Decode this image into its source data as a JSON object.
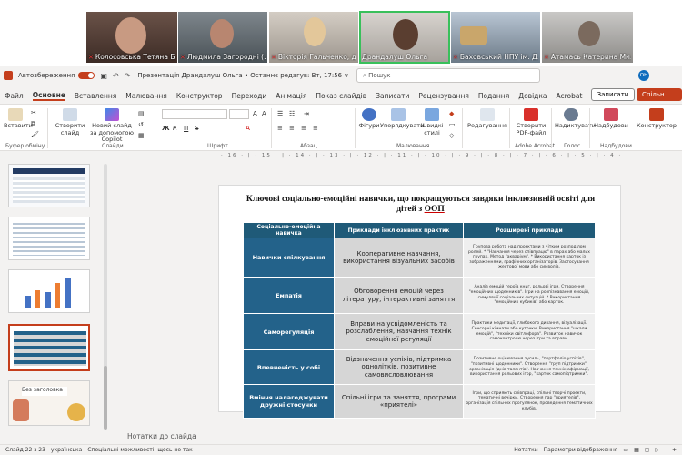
{
  "meeting": {
    "participants": [
      {
        "name": "Колосовська Тетяна Б..."
      },
      {
        "name": "Людмила Загородні (..."
      },
      {
        "name": "Вікторія Гальченко, д..."
      },
      {
        "name": "Драндалуш Ольга"
      },
      {
        "name": "Баховський НПУ ім. Д..."
      },
      {
        "name": "Атамась Катерина Ми..."
      }
    ]
  },
  "titlebar": {
    "autosave_label": "Автозбереження",
    "doc_title": "Презентація Драндалуш Ольга • Останнє редагув: Вт, 17:56 ∨",
    "search_placeholder": "Пошук",
    "user_initials": "ОН"
  },
  "menu": {
    "items": [
      "Файл",
      "Основне",
      "Вставлення",
      "Малювання",
      "Конструктор",
      "Переходи",
      "Анімація",
      "Показ слайдів",
      "Записати",
      "Рецензування",
      "Подання",
      "Довідка",
      "Acrobat"
    ],
    "record_label": "Записати",
    "share_label": "Спільн"
  },
  "ribbon": {
    "paste": "Вставити",
    "create_slide": "Створити слайд",
    "new_slide_copilot": "Новий слайд за допомогою Copilot",
    "groups": {
      "clipboard": "Буфер обміну",
      "slides": "Слайди",
      "font": "Шрифт",
      "paragraph": "Абзац",
      "drawing": "Малювання",
      "voice": "Голос",
      "addins": "Надбудови"
    },
    "figures": "Фігури",
    "arrange": "Упорядкувати",
    "quick_styles": "Швидкі стилі",
    "editing": "Редагування",
    "create_pdf": "Створити PDF-файл",
    "adobe_acrobat": "Adobe Acrobat",
    "dictate": "Надиктувати",
    "addins": "Надбудови",
    "designer": "Конструктор",
    "bold": "Ж",
    "italic": "К",
    "underline": "П",
    "strike": "S"
  },
  "ruler": {
    "text": "· 16 · | · 15 · | · 14 · | · 13 · | · 12 · | · 11 · | · 10 · | · 9 · | · 8 · | · 7 · | · 6 · | · 5 · | · 4 · | · 3 · | · 2 · | · 1 · | · 0 · | · 1 · | · 2 · | · 3 · | · 4 · | · 5 · | · 6 · | · 7 · | · 8 · | · 9 · | · 10 · | · 11 · | · 12 · | · 13 · | · 14 · | · 15 · | · 16"
  },
  "thumbnails": {
    "numbers": [
      "",
      "",
      "",
      "",
      "",
      ""
    ],
    "last_label": "Без заголовка"
  },
  "slide": {
    "title_part1": "Ключові соціально-емоційні навички, що покращуються завдяки інклюзивній освіті для дітей з ",
    "title_part2": "ООП",
    "headers": [
      "Соціально-емоційна навичка",
      "Приклади інклюзивних практик",
      "Розширені приклади"
    ],
    "rows": [
      {
        "skill": "Навички спілкування",
        "practice": "Кооперативне навчання, використання візуальних засобів",
        "examples": "Групова робота над проєктами з чітким розподілом ролей. * \"Навчання через співпрацю\" в парах або малих групах. Метод \"акваріум\". * Використання карток із зображеннями, графічних організаторів. Застосування жестової мови або символів."
      },
      {
        "skill": "Емпатія",
        "practice": "Обговорення емоцій через літературу, інтерактивні заняття",
        "examples": "Аналіз емоцій героїв книг, рольові ігри. Створення \"емоційних щоденників\". Ігри на розпізнавання емоцій, симуляції соціальних ситуацій. * Використання \"емоційних кубиків\" або карток."
      },
      {
        "skill": "Саморегуляція",
        "practice": "Вправи на усвідомленість та розслаблення, навчання технік емоційної регуляції",
        "examples": "Практики медитації, глибокого дихання, візуалізації. Сенсорні кімнати або куточки. Використання \"шкали емоцій\", \"техніки світлофора\". Розвиток навичок самоконтролю через ігри та вправи."
      },
      {
        "skill": "Впевненість у собі",
        "practice": "Відзначення успіхів, підтримка однолітків, позитивне самовисловлювання",
        "examples": "Позитивне оцінювання зусиль, \"портфоліо успіхів\", \"позитивні щоденники\". Створення \"груп підтримки\", організація \"днів талантів\". Навчання технік афірмації, використання рольових ігор, \"карток самопідтримки\"."
      },
      {
        "skill": "Вміння налагоджувати дружні стосунки",
        "practice": "Спільні ігри та заняття, програми «приятелі»",
        "examples": "Ігри, що сприяють співпраці, спільні творчі проєкти, тематичні вечірки. Створення пар \"приятелів\", організація спільних прогулянок, проведення тематичних клубів."
      }
    ]
  },
  "notes": {
    "placeholder": "Нотатки до слайда"
  },
  "status": {
    "slide_info": "Слайд 22 з 23",
    "language": "українська",
    "accessibility": "Спеціальні можливості: щось не так",
    "notes": "Нотатки",
    "display": "Параметри відображення"
  }
}
